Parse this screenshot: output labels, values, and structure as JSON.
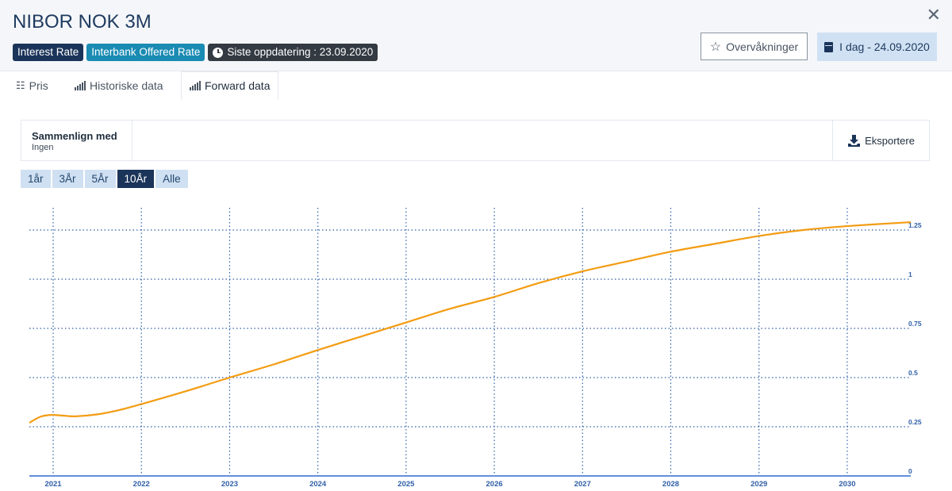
{
  "title": "NIBOR NOK 3M",
  "badges": {
    "type": "Interest Rate",
    "category": "Interbank Offered Rate",
    "updated": "Siste oppdatering : 23.09.2020"
  },
  "actions": {
    "watch": "Overvåkninger",
    "date": "I dag - 24.09.2020"
  },
  "tabs": [
    "Pris",
    "Historiske data",
    "Forward data"
  ],
  "compare": {
    "label": "Sammenlign med",
    "value": "Ingen"
  },
  "export": "Eksportere",
  "ranges": [
    "1år",
    "3År",
    "5År",
    "10År",
    "Alle"
  ],
  "colors": {
    "line": "#f39c12",
    "grid": "#2f5fa8",
    "axis": "#2f6ad0"
  },
  "chart_data": {
    "type": "line",
    "x_ticks": [
      "2021",
      "2022",
      "2023",
      "2024",
      "2025",
      "2026",
      "2027",
      "2028",
      "2029",
      "2030"
    ],
    "y_ticks": [
      "0",
      "0.25",
      "0.5",
      "0.75",
      "1",
      "1.25"
    ],
    "ylim": [
      0,
      1.3
    ],
    "xlim": [
      2020.73,
      2030.72
    ],
    "grid": true,
    "y_axis_position": "right",
    "series": [
      {
        "values": [
          [
            2020.73,
            0.27
          ],
          [
            2020.85,
            0.3
          ],
          [
            2020.97,
            0.31
          ],
          [
            2021.1,
            0.307
          ],
          [
            2021.25,
            0.303
          ],
          [
            2021.5,
            0.313
          ],
          [
            2021.75,
            0.335
          ],
          [
            2022.0,
            0.365
          ],
          [
            2022.5,
            0.43
          ],
          [
            2023.0,
            0.5
          ],
          [
            2023.5,
            0.567
          ],
          [
            2024.0,
            0.64
          ],
          [
            2024.5,
            0.71
          ],
          [
            2025.0,
            0.78
          ],
          [
            2025.5,
            0.85
          ],
          [
            2026.0,
            0.91
          ],
          [
            2026.5,
            0.98
          ],
          [
            2027.0,
            1.04
          ],
          [
            2027.5,
            1.09
          ],
          [
            2028.0,
            1.14
          ],
          [
            2028.5,
            1.18
          ],
          [
            2029.0,
            1.22
          ],
          [
            2029.5,
            1.25
          ],
          [
            2030.0,
            1.27
          ],
          [
            2030.72,
            1.29
          ]
        ]
      }
    ]
  }
}
